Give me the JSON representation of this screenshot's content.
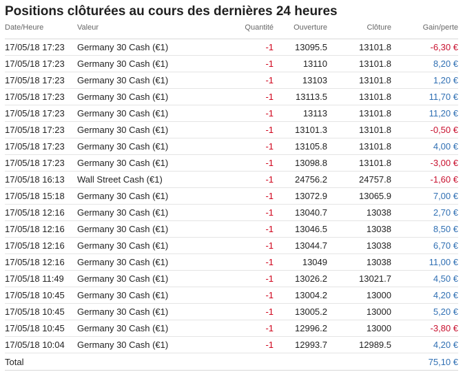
{
  "title": "Positions clôturées au cours des dernières 24 heures",
  "columns": [
    "Date/Heure",
    "Valeur",
    "Quantité",
    "Ouverture",
    "Clôture",
    "Gain/perte"
  ],
  "rows": [
    {
      "date": "17/05/18 17:23",
      "valeur": "Germany 30 Cash (€1)",
      "quantite": "-1",
      "ouverture": "13095.5",
      "cloture": "13101.8",
      "gain": "-6,30 €",
      "sign": "neg"
    },
    {
      "date": "17/05/18 17:23",
      "valeur": "Germany 30 Cash (€1)",
      "quantite": "-1",
      "ouverture": "13110",
      "cloture": "13101.8",
      "gain": "8,20 €",
      "sign": "pos"
    },
    {
      "date": "17/05/18 17:23",
      "valeur": "Germany 30 Cash (€1)",
      "quantite": "-1",
      "ouverture": "13103",
      "cloture": "13101.8",
      "gain": "1,20 €",
      "sign": "pos"
    },
    {
      "date": "17/05/18 17:23",
      "valeur": "Germany 30 Cash (€1)",
      "quantite": "-1",
      "ouverture": "13113.5",
      "cloture": "13101.8",
      "gain": "11,70 €",
      "sign": "pos"
    },
    {
      "date": "17/05/18 17:23",
      "valeur": "Germany 30 Cash (€1)",
      "quantite": "-1",
      "ouverture": "13113",
      "cloture": "13101.8",
      "gain": "11,20 €",
      "sign": "pos"
    },
    {
      "date": "17/05/18 17:23",
      "valeur": "Germany 30 Cash (€1)",
      "quantite": "-1",
      "ouverture": "13101.3",
      "cloture": "13101.8",
      "gain": "-0,50 €",
      "sign": "neg"
    },
    {
      "date": "17/05/18 17:23",
      "valeur": "Germany 30 Cash (€1)",
      "quantite": "-1",
      "ouverture": "13105.8",
      "cloture": "13101.8",
      "gain": "4,00 €",
      "sign": "pos"
    },
    {
      "date": "17/05/18 17:23",
      "valeur": "Germany 30 Cash (€1)",
      "quantite": "-1",
      "ouverture": "13098.8",
      "cloture": "13101.8",
      "gain": "-3,00 €",
      "sign": "neg"
    },
    {
      "date": "17/05/18 16:13",
      "valeur": "Wall Street Cash (€1)",
      "quantite": "-1",
      "ouverture": "24756.2",
      "cloture": "24757.8",
      "gain": "-1,60 €",
      "sign": "neg"
    },
    {
      "date": "17/05/18 15:18",
      "valeur": "Germany 30 Cash (€1)",
      "quantite": "-1",
      "ouverture": "13072.9",
      "cloture": "13065.9",
      "gain": "7,00 €",
      "sign": "pos"
    },
    {
      "date": "17/05/18 12:16",
      "valeur": "Germany 30 Cash (€1)",
      "quantite": "-1",
      "ouverture": "13040.7",
      "cloture": "13038",
      "gain": "2,70 €",
      "sign": "pos"
    },
    {
      "date": "17/05/18 12:16",
      "valeur": "Germany 30 Cash (€1)",
      "quantite": "-1",
      "ouverture": "13046.5",
      "cloture": "13038",
      "gain": "8,50 €",
      "sign": "pos"
    },
    {
      "date": "17/05/18 12:16",
      "valeur": "Germany 30 Cash (€1)",
      "quantite": "-1",
      "ouverture": "13044.7",
      "cloture": "13038",
      "gain": "6,70 €",
      "sign": "pos"
    },
    {
      "date": "17/05/18 12:16",
      "valeur": "Germany 30 Cash (€1)",
      "quantite": "-1",
      "ouverture": "13049",
      "cloture": "13038",
      "gain": "11,00 €",
      "sign": "pos"
    },
    {
      "date": "17/05/18 11:49",
      "valeur": "Germany 30 Cash (€1)",
      "quantite": "-1",
      "ouverture": "13026.2",
      "cloture": "13021.7",
      "gain": "4,50 €",
      "sign": "pos"
    },
    {
      "date": "17/05/18 10:45",
      "valeur": "Germany 30 Cash (€1)",
      "quantite": "-1",
      "ouverture": "13004.2",
      "cloture": "13000",
      "gain": "4,20 €",
      "sign": "pos"
    },
    {
      "date": "17/05/18 10:45",
      "valeur": "Germany 30 Cash (€1)",
      "quantite": "-1",
      "ouverture": "13005.2",
      "cloture": "13000",
      "gain": "5,20 €",
      "sign": "pos"
    },
    {
      "date": "17/05/18 10:45",
      "valeur": "Germany 30 Cash (€1)",
      "quantite": "-1",
      "ouverture": "12996.2",
      "cloture": "13000",
      "gain": "-3,80 €",
      "sign": "neg"
    },
    {
      "date": "17/05/18 10:04",
      "valeur": "Germany 30 Cash (€1)",
      "quantite": "-1",
      "ouverture": "12993.7",
      "cloture": "12989.5",
      "gain": "4,20 €",
      "sign": "pos"
    }
  ],
  "total": {
    "label": "Total",
    "value": "75,10 €"
  },
  "colors": {
    "positive": "#2f6fb3",
    "negative": "#c8102e",
    "quantity": "#d0021b"
  }
}
